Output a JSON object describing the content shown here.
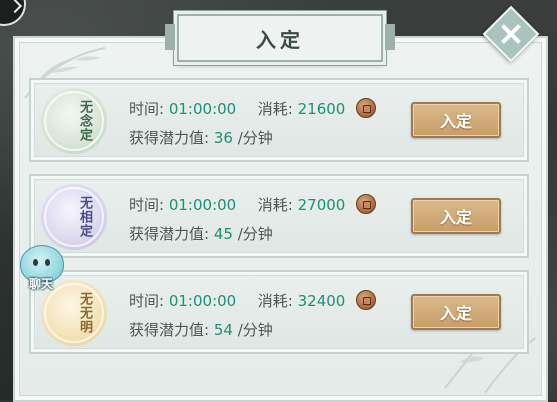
{
  "header": {
    "title": "入定"
  },
  "rows": [
    {
      "medal_text": "无念定",
      "time_label": "时间:",
      "time_value": "01:00:00",
      "cost_label": "消耗:",
      "cost_value": "21600",
      "potential_label": "获得潜力值:",
      "potential_value": "36",
      "potential_unit": "/分钟",
      "button_label": "入定"
    },
    {
      "medal_text": "无相定",
      "time_label": "时间:",
      "time_value": "01:00:00",
      "cost_label": "消耗:",
      "cost_value": "27000",
      "potential_label": "获得潜力值:",
      "potential_value": "45",
      "potential_unit": "/分钟",
      "button_label": "入定"
    },
    {
      "medal_text": "无无明",
      "time_label": "时间:",
      "time_value": "01:00:00",
      "cost_label": "消耗:",
      "cost_value": "32400",
      "potential_label": "获得潜力值:",
      "potential_value": "54",
      "potential_unit": "/分钟",
      "button_label": "入定"
    }
  ],
  "chat": {
    "label": "聊天"
  },
  "icons": {
    "back": "chevron-right-icon",
    "close": "close-icon",
    "currency": "copper-coin-icon"
  },
  "colors": {
    "value_green": "#1f8f73",
    "button_tan": "#c79e68",
    "panel_bg": "#eef3f1"
  }
}
